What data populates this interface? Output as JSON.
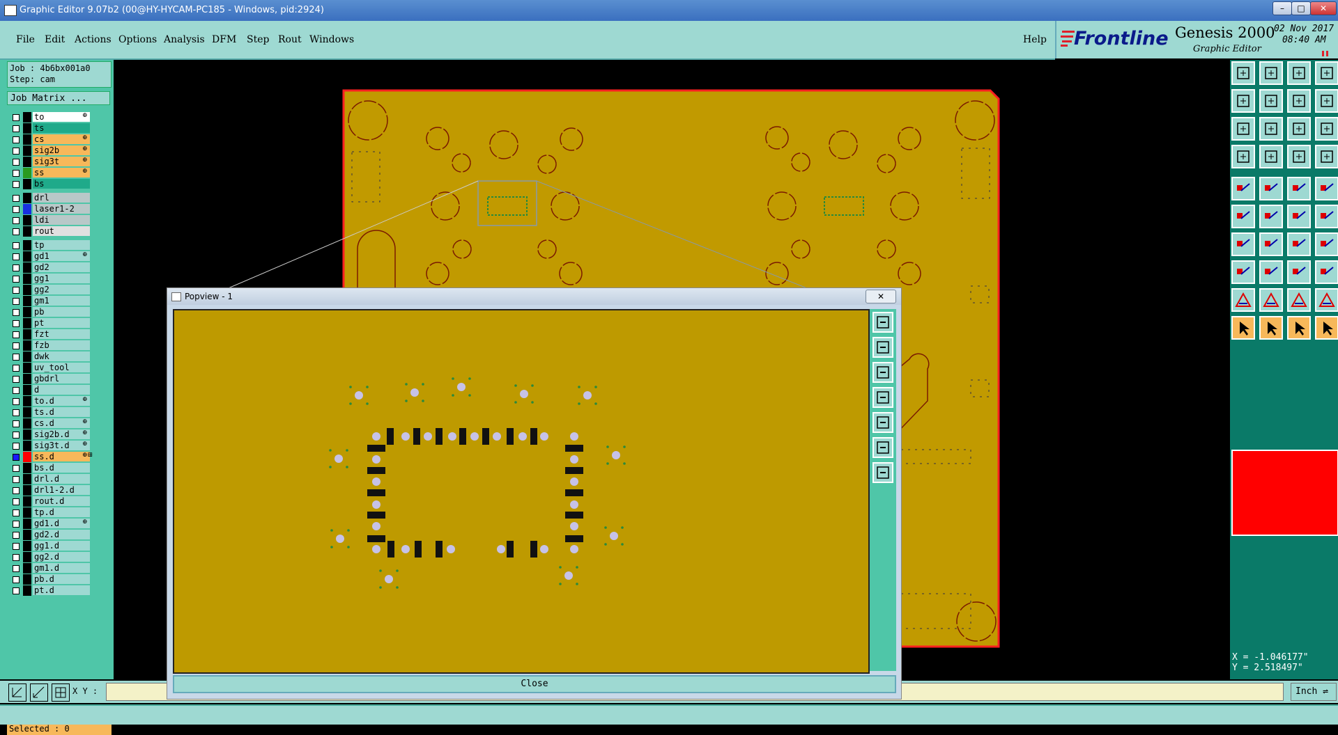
{
  "window": {
    "title": "Graphic Editor 9.07b2 (00@HY-HYCAM-PC185 - Windows, pid:2924)"
  },
  "menu": {
    "items": [
      "File",
      "Edit",
      "Actions",
      "Options",
      "Analysis",
      "DFM",
      "Step",
      "Rout",
      "Windows"
    ],
    "help": "Help"
  },
  "brand": {
    "logo": "Frontline",
    "product": "Genesis 2000",
    "subtitle": "Graphic Editor",
    "date": "02 Nov 2017",
    "time": "08:40 AM"
  },
  "job": {
    "job_label": "Job : 4b6bx001a0",
    "step_label": "Step: cam",
    "matrix_button": "Job Matrix ..."
  },
  "layers": [
    {
      "name": "to",
      "color": "#ffffff",
      "aff": "⊕"
    },
    {
      "name": "ts",
      "color": "#1faa8a",
      "aff": ""
    },
    {
      "name": "cs",
      "color": "#f7b85a",
      "aff": "⊕"
    },
    {
      "name": "sig2b",
      "color": "#f7b85a",
      "aff": "⊕"
    },
    {
      "name": "sig3t",
      "color": "#f7b85a",
      "aff": "⊕"
    },
    {
      "name": "ss",
      "color": "#f7b85a",
      "aff": "⊕",
      "swatch": "#2a9a20"
    },
    {
      "name": "bs",
      "color": "#1faa8a",
      "aff": ""
    },
    {
      "name": "drl",
      "color": "#b8c8c8",
      "aff": "",
      "gap": true
    },
    {
      "name": "laser1-2",
      "color": "#b8c8c8",
      "aff": "",
      "swatch": "#1830e0"
    },
    {
      "name": "ldi",
      "color": "#b8c8c8",
      "aff": ""
    },
    {
      "name": "rout",
      "color": "#e0e0e0",
      "aff": ""
    },
    {
      "name": "tp",
      "color": "#9ed9d2",
      "aff": "",
      "gap": true
    },
    {
      "name": "gd1",
      "color": "#9ed9d2",
      "aff": "⊕"
    },
    {
      "name": "gd2",
      "color": "#9ed9d2",
      "aff": ""
    },
    {
      "name": "gg1",
      "color": "#9ed9d2",
      "aff": ""
    },
    {
      "name": "gg2",
      "color": "#9ed9d2",
      "aff": ""
    },
    {
      "name": "gm1",
      "color": "#9ed9d2",
      "aff": ""
    },
    {
      "name": "pb",
      "color": "#9ed9d2",
      "aff": ""
    },
    {
      "name": "pt",
      "color": "#9ed9d2",
      "aff": ""
    },
    {
      "name": "fzt",
      "color": "#9ed9d2",
      "aff": ""
    },
    {
      "name": "fzb",
      "color": "#9ed9d2",
      "aff": ""
    },
    {
      "name": "dwk",
      "color": "#9ed9d2",
      "aff": ""
    },
    {
      "name": "uv_tool",
      "color": "#9ed9d2",
      "aff": ""
    },
    {
      "name": "gbdrl",
      "color": "#9ed9d2",
      "aff": ""
    },
    {
      "name": "d",
      "color": "#9ed9d2",
      "aff": ""
    },
    {
      "name": "to.d",
      "color": "#9ed9d2",
      "aff": "⊕"
    },
    {
      "name": "ts.d",
      "color": "#9ed9d2",
      "aff": ""
    },
    {
      "name": "cs.d",
      "color": "#9ed9d2",
      "aff": "⊕"
    },
    {
      "name": "sig2b.d",
      "color": "#9ed9d2",
      "aff": "⊕"
    },
    {
      "name": "sig3t.d",
      "color": "#9ed9d2",
      "aff": "⊕"
    },
    {
      "name": "ss.d",
      "color": "#f7b85a",
      "aff": "⊕⊞",
      "swatch": "#ff0000",
      "cbcolor": "#1a1aff"
    },
    {
      "name": "bs.d",
      "color": "#9ed9d2",
      "aff": ""
    },
    {
      "name": "drl.d",
      "color": "#9ed9d2",
      "aff": ""
    },
    {
      "name": "drl1-2.d",
      "color": "#9ed9d2",
      "aff": ""
    },
    {
      "name": "rout.d",
      "color": "#9ed9d2",
      "aff": ""
    },
    {
      "name": "tp.d",
      "color": "#9ed9d2",
      "aff": ""
    },
    {
      "name": "gd1.d",
      "color": "#9ed9d2",
      "aff": "⊕"
    },
    {
      "name": "gd2.d",
      "color": "#9ed9d2",
      "aff": ""
    },
    {
      "name": "gg1.d",
      "color": "#9ed9d2",
      "aff": ""
    },
    {
      "name": "gg2.d",
      "color": "#9ed9d2",
      "aff": ""
    },
    {
      "name": "gm1.d",
      "color": "#9ed9d2",
      "aff": ""
    },
    {
      "name": "pb.d",
      "color": "#9ed9d2",
      "aff": ""
    },
    {
      "name": "pt.d",
      "color": "#9ed9d2",
      "aff": ""
    }
  ],
  "status": {
    "selected": "Selected : 0"
  },
  "coords": {
    "x": "X = -1.046177\"",
    "y": "Y = 2.518497\""
  },
  "command": {
    "xy_label": "X Y :",
    "unit": "Inch"
  },
  "popview": {
    "title": "Popview - 1",
    "close": "Close"
  },
  "colors": {
    "board": "#c19a00",
    "board_outline": "#ff2020",
    "panel": "#9ed9d2",
    "panel_dark": "#4fc6a8",
    "highlight": "#f7b85a"
  }
}
